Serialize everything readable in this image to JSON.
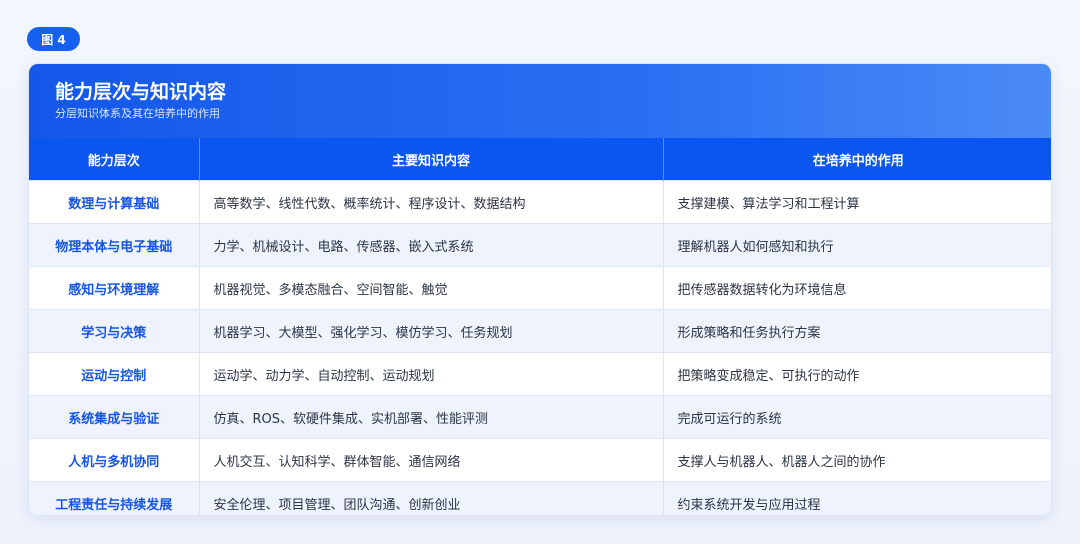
{
  "figure": {
    "label": "图 4"
  },
  "card": {
    "title": "能力层次与知识内容",
    "subtitle": "分层知识体系及其在培养中的作用"
  },
  "table": {
    "headers": [
      "能力层次",
      "主要知识内容",
      "在培养中的作用"
    ],
    "rows": [
      [
        "数理与计算基础",
        "高等数学、线性代数、概率统计、程序设计、数据结构",
        "支撑建模、算法学习和工程计算"
      ],
      [
        "物理本体与电子基础",
        "力学、机械设计、电路、传感器、嵌入式系统",
        "理解机器人如何感知和执行"
      ],
      [
        "感知与环境理解",
        "机器视觉、多模态融合、空间智能、触觉",
        "把传感器数据转化为环境信息"
      ],
      [
        "学习与决策",
        "机器学习、大模型、强化学习、模仿学习、任务规划",
        "形成策略和任务执行方案"
      ],
      [
        "运动与控制",
        "运动学、动力学、自动控制、运动规划",
        "把策略变成稳定、可执行的动作"
      ],
      [
        "系统集成与验证",
        "仿真、ROS、软硬件集成、实机部署、性能评测",
        "完成可运行的系统"
      ],
      [
        "人机与多机协同",
        "人机交互、认知科学、群体智能、通信网络",
        "支撑人与机器人、机器人之间的协作"
      ],
      [
        "工程责任与持续发展",
        "安全伦理、项目管理、团队沟通、创新创业",
        "约束系统开发与应用过程"
      ]
    ]
  },
  "colors": {
    "accent": "#1560f0",
    "header_bg": "#0b55f0",
    "level_text": "#1655e6",
    "row_alt": "#eef3fd"
  }
}
